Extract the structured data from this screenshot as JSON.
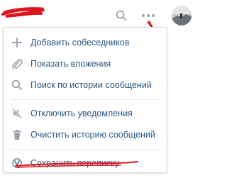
{
  "menu": {
    "items": [
      {
        "label": "Добавить собеседников",
        "icon": "plus-icon"
      },
      {
        "label": "Показать вложения",
        "icon": "paperclip-icon"
      },
      {
        "label": "Поиск по истории сообщений",
        "icon": "search-icon"
      },
      {
        "label": "Отключить уведомления",
        "icon": "mute-icon"
      },
      {
        "label": "Очистить историю сообщений",
        "icon": "trash-icon"
      },
      {
        "label": "Сохранить переписку",
        "icon": "vk-saver-icon"
      }
    ]
  },
  "colors": {
    "link": "#2a5885",
    "icon": "#99a2ad",
    "annotation": "#e0141e",
    "border": "#d3d9de"
  }
}
